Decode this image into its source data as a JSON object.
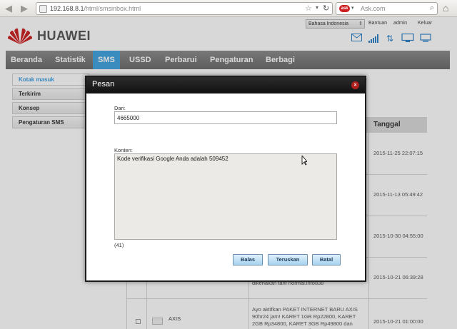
{
  "browser": {
    "url_host": "192.168.8.1",
    "url_path": "/html/smsinbox.html",
    "search_placeholder": "Ask.com",
    "search_logo": "ask"
  },
  "header": {
    "brand": "HUAWEI",
    "language": "Bahasa Indonesia",
    "help": "Bantuan",
    "user": "admin",
    "logout": "Keluar"
  },
  "nav": {
    "items": [
      "Beranda",
      "Statistik",
      "SMS",
      "USSD",
      "Perbarui",
      "Pengaturan",
      "Berbagi"
    ],
    "active": "SMS"
  },
  "sidebar": {
    "items": [
      "Kotak masuk",
      "Terkirim",
      "Konsep",
      "Pengaturan SMS"
    ]
  },
  "table": {
    "date_header": "Tanggal",
    "rows": [
      {
        "date": "2015-11-25 22:07:15"
      },
      {
        "date": "2015-11-13 05:49:42"
      },
      {
        "date": "2015-10-30 04:55:00"
      },
      {
        "date": "2015-10-21 06:39:28",
        "message": "dikenakan tarif normal.info838"
      },
      {
        "date": "2015-10-21 01:00:00",
        "sender": "AXIS",
        "message": "Ayo aktifkan PAKET INTERNET BARU AXIS 90hr24 jam! KARET 1GB Rp22800, KARET 2GB Rp34800, KARET 3GB Rp49800 dan KARET 5GB Rp89900 di *123*888#"
      }
    ]
  },
  "modal": {
    "title": "Pesan",
    "close": "×",
    "from_label": "Dari:",
    "from_value": "4665000",
    "content_label": "Konten:",
    "content_value": "Kode verifikasi Google Anda adalah 509452",
    "char_count": "(41)",
    "reply_label": "Balas",
    "forward_label": "Teruskan",
    "cancel_label": "Batal"
  },
  "colors": {
    "accent": "#3fa2e0",
    "brand_red": "#cc1f1f",
    "nav_bg": "#7a7a7a",
    "modal_header": "#1a1a1a"
  }
}
